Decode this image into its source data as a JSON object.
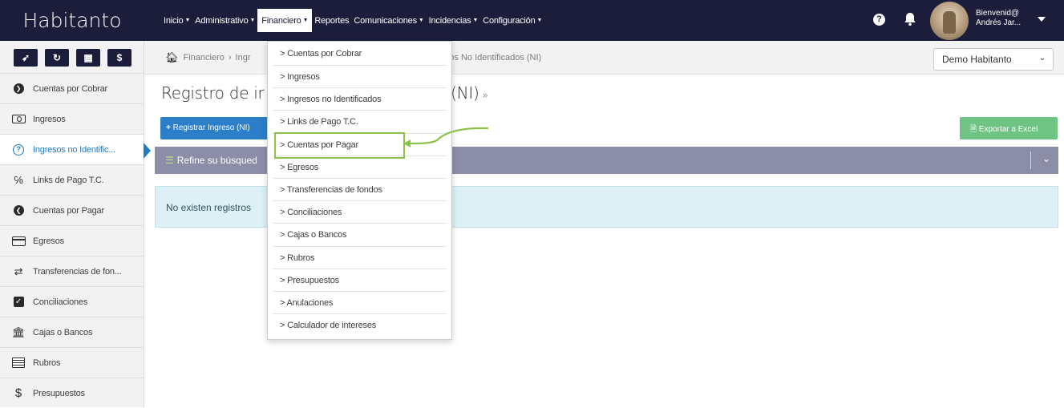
{
  "brand": "Habitanto",
  "topnav": [
    {
      "label": "Inicio",
      "active": false
    },
    {
      "label": "Administrativo",
      "active": false
    },
    {
      "label": "Financiero",
      "active": true
    },
    {
      "label": "Reportes",
      "active": false
    },
    {
      "label": "Comunicaciones",
      "active": false
    },
    {
      "label": "Incidencias",
      "active": false
    },
    {
      "label": "Configuración",
      "active": false
    }
  ],
  "user": {
    "greeting": "Bienvenid@",
    "name": "Andrés Jar..."
  },
  "quick_buttons": [
    "send-icon",
    "refresh-icon",
    "calculator-icon",
    "dollar-icon"
  ],
  "sidebar": [
    {
      "label": "Cuentas por Cobrar",
      "icon": "arrow-circle-right-icon"
    },
    {
      "label": "Ingresos",
      "icon": "money-bill-icon"
    },
    {
      "label": "Ingresos no Identific...",
      "icon": "question-circle-icon",
      "active": true
    },
    {
      "label": "Links de Pago T.C.",
      "icon": "link-icon"
    },
    {
      "label": "Cuentas por Pagar",
      "icon": "arrow-circle-left-icon"
    },
    {
      "label": "Egresos",
      "icon": "credit-card-icon"
    },
    {
      "label": "Transferencias de fon...",
      "icon": "exchange-icon"
    },
    {
      "label": "Conciliaciones",
      "icon": "check-square-icon"
    },
    {
      "label": "Cajas o Bancos",
      "icon": "bank-icon"
    },
    {
      "label": "Rubros",
      "icon": "list-alt-icon"
    },
    {
      "label": "Presupuestos",
      "icon": "dollar-icon"
    }
  ],
  "breadcrumb": {
    "first": "Financiero",
    "second_fragment": "Ingr",
    "tail": "resos No Identificados (NI)"
  },
  "select_value": "Demo Habitanto",
  "page_title": {
    "left": "Registro de ir",
    "right": "s (NI)",
    "raquo": "»"
  },
  "buttons": {
    "register": "Registrar Ingreso (NI)",
    "export": "Exportar a Excel"
  },
  "filter_bar": {
    "label": "Refine su búsqued"
  },
  "alert_text": "No existen registros",
  "dropdown": [
    "> Cuentas por Cobrar",
    "> Ingresos",
    "> Ingresos no Identificados",
    "> Links de Pago T.C.",
    "> Cuentas por Pagar",
    "> Egresos",
    "> Transferencias de fondos",
    "> Conciliaciones",
    "> Cajas o Bancos",
    "> Rubros",
    "> Presupuestos",
    "> Anulaciones",
    "> Calculador de intereses"
  ],
  "colors": {
    "navbar": "#1c1d3a",
    "accent_blue": "#2c7ec8",
    "excel_green": "#6fc383",
    "filter_bar": "#8c8ea8",
    "alert_bg": "#dcf0f6",
    "highlight": "#8bc34a"
  }
}
